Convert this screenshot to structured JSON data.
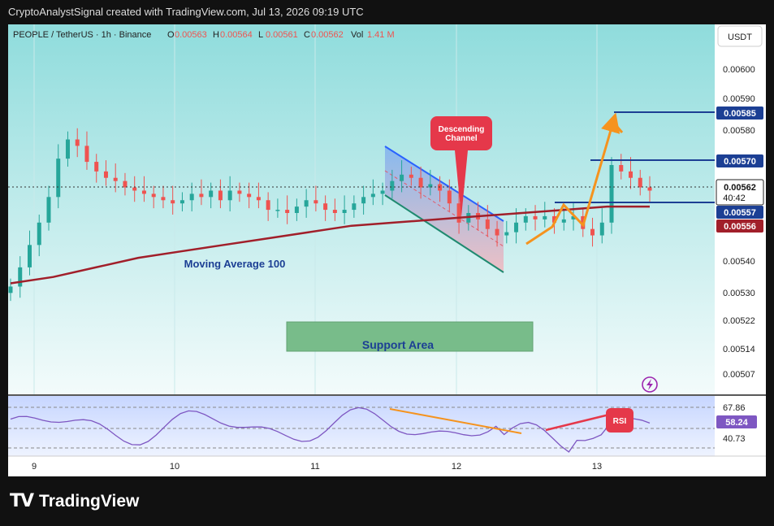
{
  "header": {
    "attribution": "CryptoAnalystSignal created with TradingView.com, Jul 13, 2026 09:19 UTC"
  },
  "legend": {
    "symbol": "PEOPLE / TetherUS · 1h · Binance",
    "o_label": "O",
    "o_value": "0.00563",
    "h_label": "H",
    "h_value": "0.00564",
    "l_label": "L",
    "l_value": "0.00561",
    "c_label": "C",
    "c_value": "0.00562",
    "vol_label": "Vol",
    "vol_value": "1.41 M"
  },
  "currency_button": "USDT",
  "footer": {
    "brand": "TradingView"
  },
  "colors": {
    "up": "#26a69a",
    "down": "#ef5350",
    "ma": "#a11f2a",
    "blue": "#1c3f94",
    "orange": "#f5931e",
    "rsi": "#7e57c2"
  },
  "chart_data": [
    {
      "type": "candlestick",
      "price_axis": {
        "ticks": [
          "0.00600",
          "0.00590",
          "0.00580",
          "0.00570",
          "0.00562",
          "0.00557",
          "0.00556",
          "0.00540",
          "0.00530",
          "0.00522",
          "0.00514",
          "0.00507"
        ]
      },
      "time_axis": {
        "ticks": [
          "9",
          "10",
          "11",
          "12",
          "13"
        ]
      },
      "badges": {
        "level_585": "0.00585",
        "level_570": "0.00570",
        "last_price": "0.00562",
        "countdown": "40:42",
        "level_557": "0.00557",
        "ma_value": "0.00556"
      },
      "annotations": {
        "ma_label": "Moving Average 100",
        "support_label": "Support Area",
        "channel_line1": "Descending",
        "channel_line2": "Channel"
      },
      "close_path": [
        0.00532,
        0.00538,
        0.00545,
        0.00552,
        0.0056,
        0.00572,
        0.00578,
        0.00576,
        0.00571,
        0.00568,
        0.00566,
        0.00565,
        0.00563,
        0.00562,
        0.00561,
        0.0056,
        0.00559,
        0.00558,
        0.00559,
        0.00561,
        0.0056,
        0.00562,
        0.00559,
        0.00562,
        0.00561,
        0.0056,
        0.00559,
        0.00556,
        0.00556,
        0.00555,
        0.00557,
        0.00559,
        0.00558,
        0.00556,
        0.00555,
        0.00556,
        0.00558,
        0.0056,
        0.00561,
        0.00562,
        0.00565,
        0.00567,
        0.00566,
        0.00563,
        0.00564,
        0.00562,
        0.00558,
        0.00552,
        0.00555,
        0.00553,
        0.0055,
        0.00548,
        0.00549,
        0.00552,
        0.00554,
        0.00553,
        0.00554,
        0.00552,
        0.00553,
        0.00554,
        0.0055,
        0.00548,
        0.00552,
        0.0057,
        0.00568,
        0.00566,
        0.00563,
        0.00562
      ],
      "ma100": [
        0.00533,
        0.00535,
        0.00538,
        0.00541,
        0.00543,
        0.00545,
        0.00547,
        0.00549,
        0.00551,
        0.00552,
        0.00553,
        0.00554,
        0.00555,
        0.00556,
        0.00557,
        0.00557
      ],
      "rsi": {
        "ticks": [
          "67.86",
          "58.24",
          "40.73"
        ],
        "current": "58.24",
        "label": "RSI"
      }
    }
  ]
}
